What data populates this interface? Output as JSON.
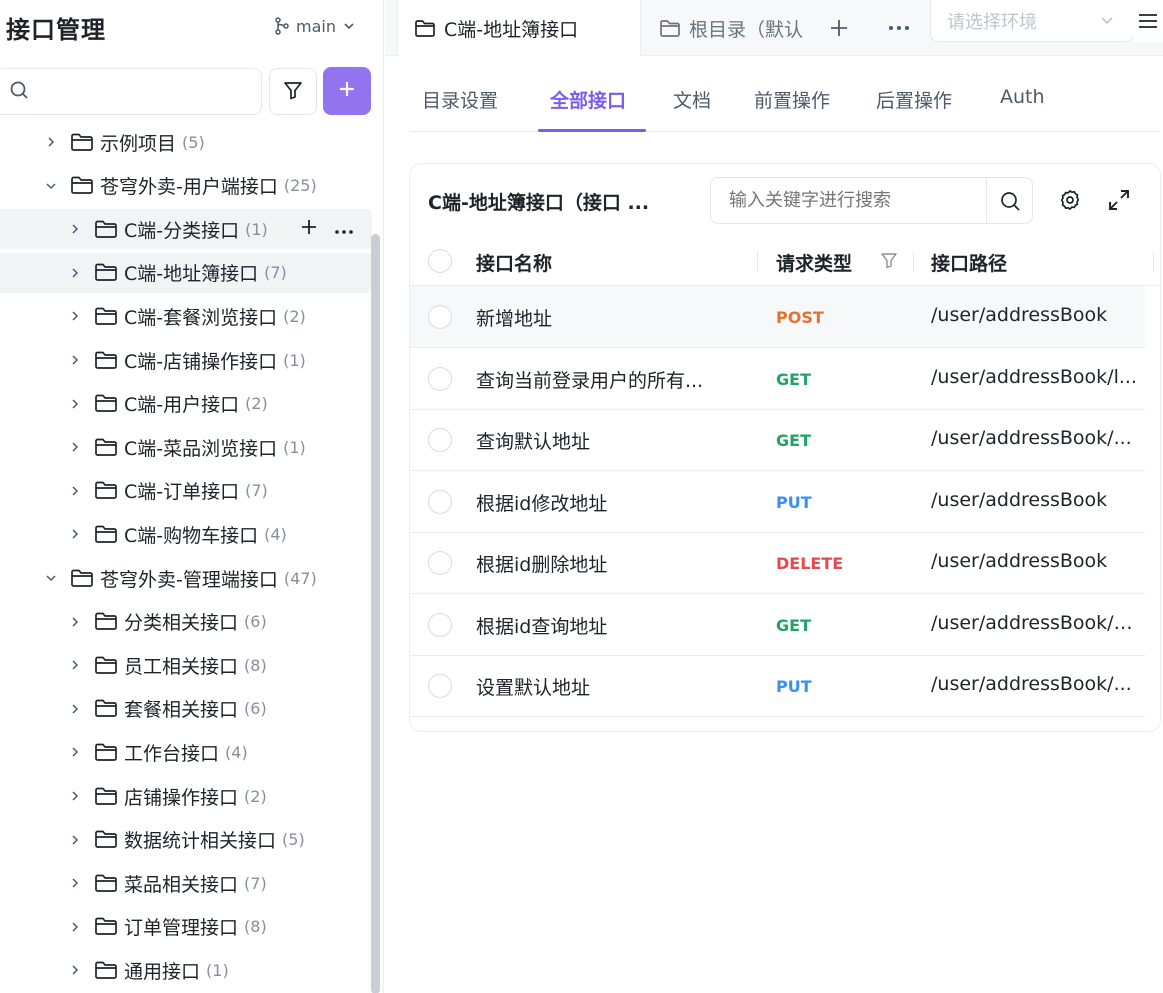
{
  "sidebar": {
    "title": "接口管理",
    "branch": "main",
    "search_placeholder": "",
    "tree": [
      {
        "label": "示例项目",
        "count": "(5)",
        "level": 1,
        "expanded": false
      },
      {
        "label": "苍穹外卖-用户端接口",
        "count": "(25)",
        "level": 1,
        "expanded": true
      },
      {
        "label": "C端-分类接口",
        "count": "(1)",
        "level": 2,
        "expanded": false
      },
      {
        "label": "C端-地址簿接口",
        "count": "(7)",
        "level": 2,
        "expanded": false
      },
      {
        "label": "C端-套餐浏览接口",
        "count": "(2)",
        "level": 2,
        "expanded": false
      },
      {
        "label": "C端-店铺操作接口",
        "count": "(1)",
        "level": 2,
        "expanded": false
      },
      {
        "label": "C端-用户接口",
        "count": "(2)",
        "level": 2,
        "expanded": false
      },
      {
        "label": "C端-菜品浏览接口",
        "count": "(1)",
        "level": 2,
        "expanded": false
      },
      {
        "label": "C端-订单接口",
        "count": "(7)",
        "level": 2,
        "expanded": false
      },
      {
        "label": "C端-购物车接口",
        "count": "(4)",
        "level": 2,
        "expanded": false
      },
      {
        "label": "苍穹外卖-管理端接口",
        "count": "(47)",
        "level": 1,
        "expanded": true
      },
      {
        "label": "分类相关接口",
        "count": "(6)",
        "level": 2,
        "expanded": false
      },
      {
        "label": "员工相关接口",
        "count": "(8)",
        "level": 2,
        "expanded": false
      },
      {
        "label": "套餐相关接口",
        "count": "(6)",
        "level": 2,
        "expanded": false
      },
      {
        "label": "工作台接口",
        "count": "(4)",
        "level": 2,
        "expanded": false
      },
      {
        "label": "店铺操作接口",
        "count": "(2)",
        "level": 2,
        "expanded": false
      },
      {
        "label": "数据统计相关接口",
        "count": "(5)",
        "level": 2,
        "expanded": false
      },
      {
        "label": "菜品相关接口",
        "count": "(7)",
        "level": 2,
        "expanded": false
      },
      {
        "label": "订单管理接口",
        "count": "(8)",
        "level": 2,
        "expanded": false
      },
      {
        "label": "通用接口",
        "count": "(1)",
        "level": 2,
        "expanded": false
      }
    ]
  },
  "tabs": {
    "active": "C端-地址簿接口",
    "inactive": "根目录（默认",
    "env_placeholder": "请选择环境"
  },
  "subtabs": [
    "目录设置",
    "全部接口",
    "文档",
    "前置操作",
    "后置操作",
    "Auth"
  ],
  "card": {
    "title": "C端-地址簿接口（接口 ...",
    "search_placeholder": "输入关键字进行搜索",
    "columns": [
      "接口名称",
      "请求类型",
      "接口路径"
    ],
    "rows": [
      {
        "name": "新增地址",
        "method": "POST",
        "path": "/user/addressBook"
      },
      {
        "name": "查询当前登录用户的所有...",
        "method": "GET",
        "path": "/user/addressBook/l..."
      },
      {
        "name": "查询默认地址",
        "method": "GET",
        "path": "/user/addressBook/..."
      },
      {
        "name": "根据id修改地址",
        "method": "PUT",
        "path": "/user/addressBook"
      },
      {
        "name": "根据id删除地址",
        "method": "DELETE",
        "path": "/user/addressBook"
      },
      {
        "name": "根据id查询地址",
        "method": "GET",
        "path": "/user/addressBook/{..."
      },
      {
        "name": "设置默认地址",
        "method": "PUT",
        "path": "/user/addressBook/..."
      }
    ]
  },
  "colors": {
    "accent": "#7c5cec",
    "add_button": "#9373ee",
    "POST": "#e8702a",
    "GET": "#21a366",
    "PUT": "#3b8ff0",
    "DELETE": "#e5484d"
  }
}
